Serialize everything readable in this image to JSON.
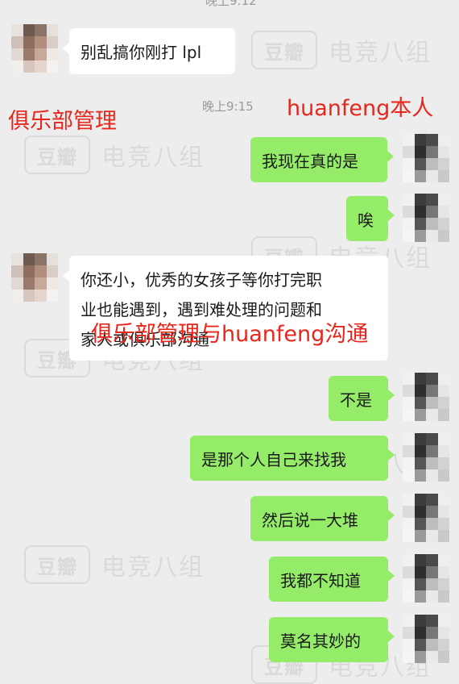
{
  "top_time_partial": "晚上9:12",
  "time_label": "晚上9:15",
  "watermark": {
    "logo": "豆瓣",
    "text": "电竞八组"
  },
  "annotations": {
    "left_label": "俱乐部管理",
    "right_label": "huanfeng本人",
    "overlay_label": "俱乐部管理与huanfeng沟通"
  },
  "messages": [
    {
      "side": "in",
      "text": "别乱搞你刚打 lpl"
    },
    {
      "side": "out",
      "text": "我现在真的是"
    },
    {
      "side": "out",
      "text": "唉"
    },
    {
      "side": "in",
      "line1": "你还小，优秀的女孩子等你打完职",
      "line2": "业也能遇到，遇到难处理的问题和",
      "line3": "家人或俱乐部沟通"
    },
    {
      "side": "out",
      "text": "不是"
    },
    {
      "side": "out",
      "text": "是那个人自己来找我"
    },
    {
      "side": "out",
      "text": "然后说一大堆"
    },
    {
      "side": "out",
      "text": "我都不知道"
    },
    {
      "side": "out",
      "text": "莫名其妙的"
    }
  ],
  "colors": {
    "incoming_bubble": "#ffffff",
    "outgoing_bubble": "#95ec69",
    "annotation": "#e8261c",
    "background": "#ededed"
  }
}
